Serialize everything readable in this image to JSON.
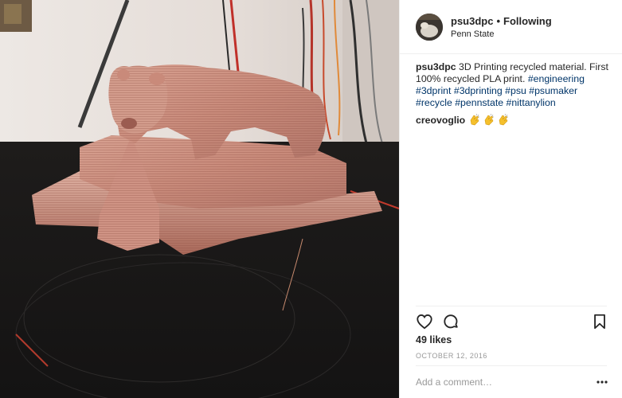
{
  "post": {
    "username": "psu3dpc",
    "separator": "•",
    "follow_status": "Following",
    "location": "Penn State",
    "caption_user": "psu3dpc",
    "caption_text": " 3D Printing recycled material. First 100% recycled PLA print. ",
    "hashtags": [
      "#engineering",
      "#3dprint",
      "#3dprinting",
      "#psu",
      "#psumaker",
      "#recycle",
      "#pennstate",
      "#nittanylion"
    ],
    "comments": [
      {
        "user": "creovoglio",
        "emoji_count": 3
      }
    ],
    "likes_text": "49 likes",
    "date": "OCTOBER 12, 2016",
    "comment_placeholder": "Add a comment…"
  },
  "icons": {
    "like": "heart-outline-icon",
    "comment": "speech-bubble-icon",
    "save": "bookmark-icon",
    "more": "ellipsis-icon",
    "clap": "clapping-hands-emoji"
  },
  "colors": {
    "hashtag": "#003569",
    "text": "#262626",
    "muted": "#999999",
    "divider": "#efefef",
    "clap": "#f5c02c"
  }
}
